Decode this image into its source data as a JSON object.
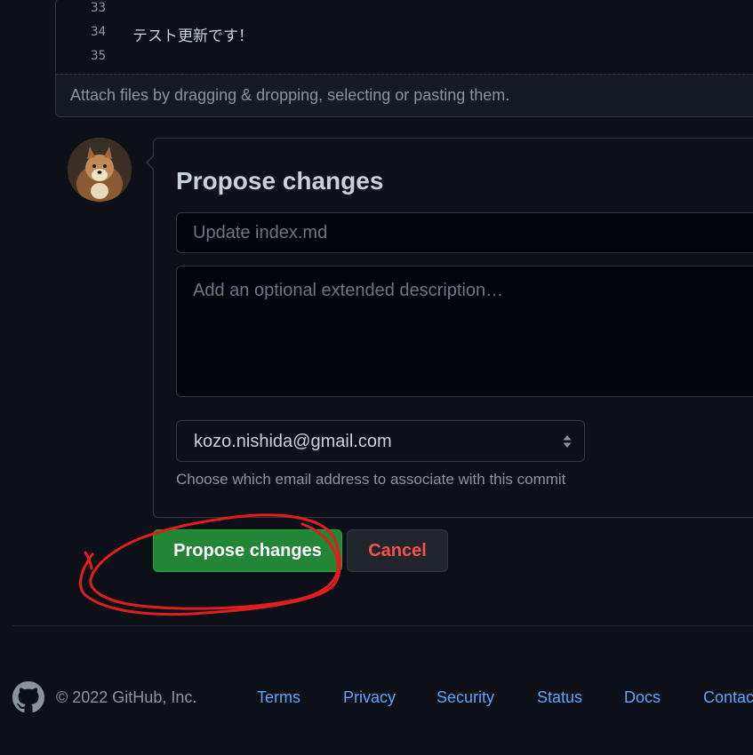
{
  "editor": {
    "lines": [
      {
        "number": "33",
        "text": ""
      },
      {
        "number": "34",
        "text": "テスト更新です！"
      },
      {
        "number": "35",
        "text": ""
      }
    ],
    "attach_hint": "Attach files by dragging & dropping, selecting or pasting them."
  },
  "propose": {
    "title": "Propose changes",
    "summary_placeholder": "Update index.md",
    "summary_value": "",
    "description_placeholder": "Add an optional extended description…",
    "description_value": "",
    "email_selected": "kozo.nishida@gmail.com",
    "email_hint": "Choose which email address to associate with this commit"
  },
  "actions": {
    "propose_label": "Propose changes",
    "cancel_label": "Cancel"
  },
  "annotation": {
    "color": "#e01e1e",
    "shape": "hand-drawn-circle"
  },
  "footer": {
    "copyright": "© 2022 GitHub, Inc.",
    "links": [
      "Terms",
      "Privacy",
      "Security",
      "Status",
      "Docs",
      "Contact GitHub"
    ]
  },
  "colors": {
    "background": "#0d1117",
    "primary_button": "#238636",
    "danger_text": "#f85149",
    "link": "#58a6ff"
  },
  "icons": {
    "select_arrows": "select-arrows-icon",
    "footer_logo": "github-logo-icon"
  }
}
